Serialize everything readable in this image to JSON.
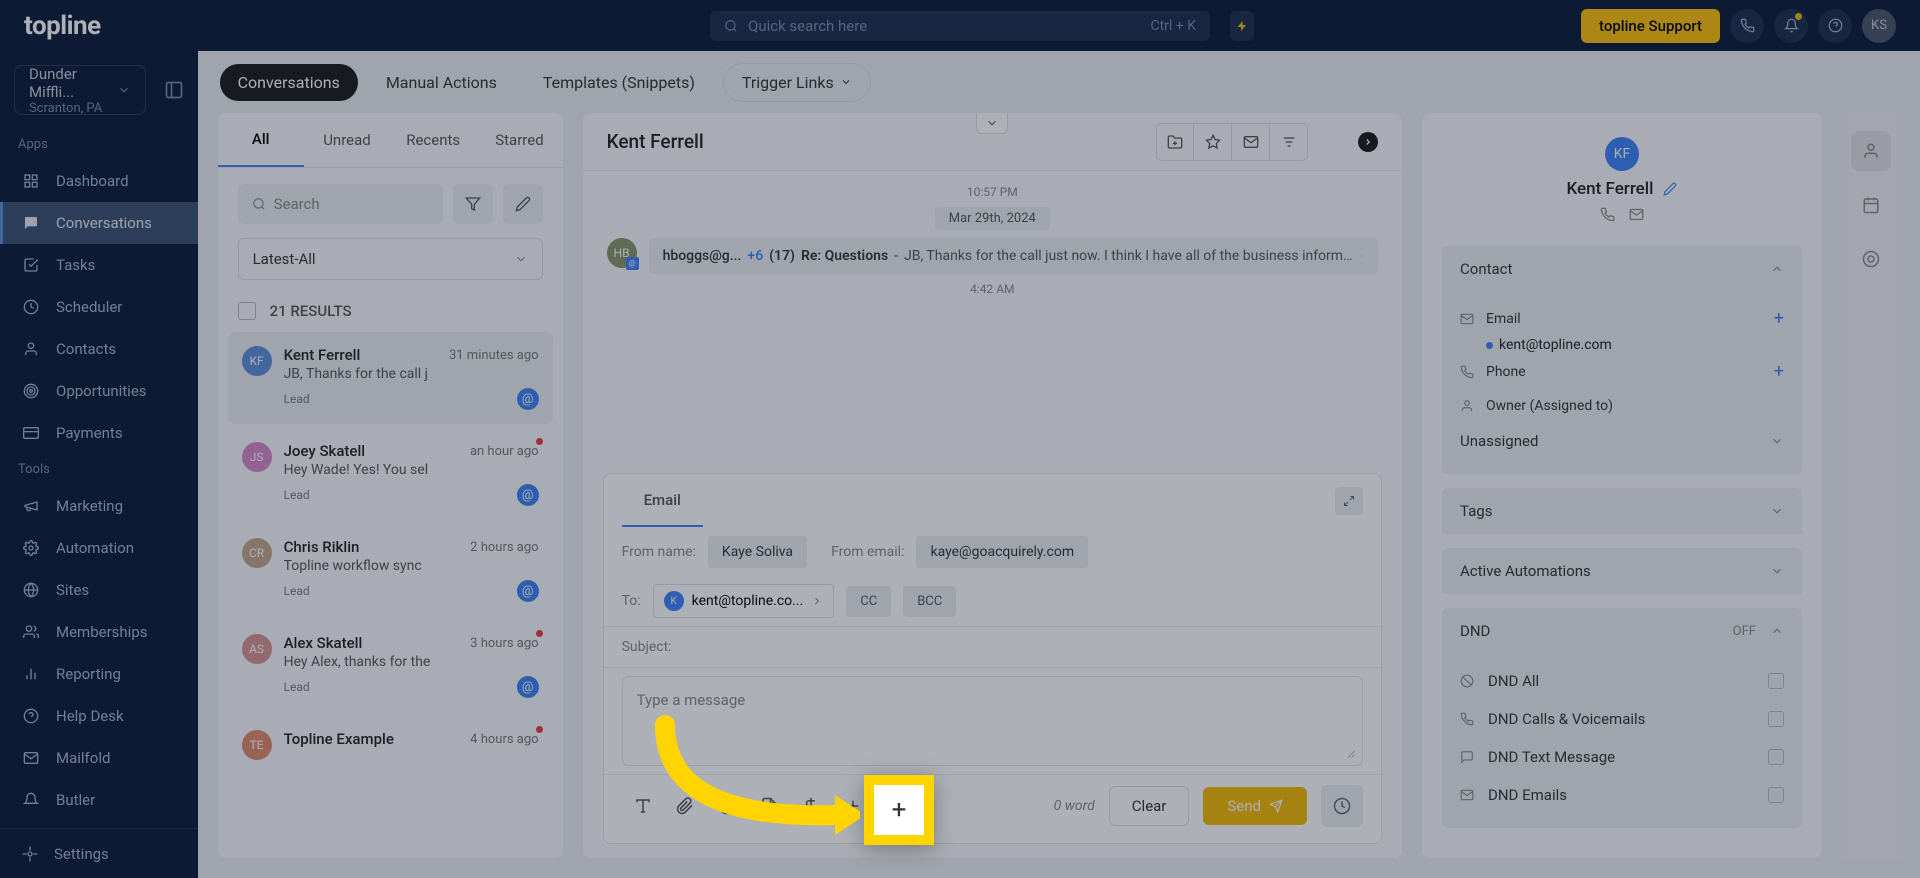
{
  "brand": "topline",
  "search": {
    "placeholder": "Quick search here",
    "shortcut": "Ctrl + K"
  },
  "support_label": "topline Support",
  "avatar_initials": "KS",
  "account": {
    "name": "Dunder Miffli...",
    "location": "Scranton, PA"
  },
  "sidebar": {
    "apps_label": "Apps",
    "tools_label": "Tools",
    "apps": [
      {
        "label": "Dashboard",
        "icon": "grid"
      },
      {
        "label": "Conversations",
        "icon": "chat",
        "active": true
      },
      {
        "label": "Tasks",
        "icon": "check"
      },
      {
        "label": "Scheduler",
        "icon": "clock"
      },
      {
        "label": "Contacts",
        "icon": "user"
      },
      {
        "label": "Opportunities",
        "icon": "target"
      },
      {
        "label": "Payments",
        "icon": "card"
      }
    ],
    "tools": [
      {
        "label": "Marketing",
        "icon": "megaphone"
      },
      {
        "label": "Automation",
        "icon": "gear"
      },
      {
        "label": "Sites",
        "icon": "globe"
      },
      {
        "label": "Memberships",
        "icon": "users"
      },
      {
        "label": "Reporting",
        "icon": "chart"
      },
      {
        "label": "Help Desk",
        "icon": "help"
      },
      {
        "label": "Mailfold",
        "icon": "mail"
      },
      {
        "label": "Butler",
        "icon": "bell"
      }
    ],
    "settings_label": "Settings"
  },
  "tabs": [
    {
      "label": "Conversations",
      "active": true
    },
    {
      "label": "Manual Actions"
    },
    {
      "label": "Templates (Snippets)"
    },
    {
      "label": "Trigger Links",
      "dropdown": true
    }
  ],
  "conv": {
    "tabs": [
      "All",
      "Unread",
      "Recents",
      "Starred"
    ],
    "search_placeholder": "Search",
    "filter": "Latest-All",
    "results_label": "21 RESULTS",
    "items": [
      {
        "initials": "KF",
        "color": "#5a8fd8",
        "name": "Kent Ferrell",
        "time": "31 minutes ago",
        "preview": "JB, Thanks for the call j",
        "tag": "Lead",
        "selected": true
      },
      {
        "initials": "JS",
        "color": "#d688c8",
        "name": "Joey Skatell",
        "time": "an hour ago",
        "preview": "Hey Wade! Yes! You sel",
        "tag": "Lead",
        "red": true
      },
      {
        "initials": "CR",
        "color": "#c0a688",
        "name": "Chris Riklin",
        "time": "2 hours ago",
        "preview": "Topline workflow sync",
        "tag": "Lead"
      },
      {
        "initials": "AS",
        "color": "#d4928f",
        "name": "Alex Skatell",
        "time": "3 hours ago",
        "preview": "Hey Alex, thanks for the",
        "tag": "Lead",
        "red": true
      },
      {
        "initials": "TE",
        "color": "#e08a6a",
        "name": "Topline Example",
        "time": "4 hours ago",
        "preview": "",
        "tag": "",
        "red": true
      }
    ]
  },
  "thread": {
    "title": "Kent Ferrell",
    "time1": "10:57 PM",
    "date": "Mar 29th, 2024",
    "msg": {
      "initials": "HB",
      "from": "hboggs@g...",
      "plus": "+6",
      "count": "(17)",
      "subject": "Re: Questions",
      "sep": "-",
      "preview": "JB, Thanks for the call just now.  I think I have all of the business informatio..."
    },
    "time2": "4:42 AM"
  },
  "composer": {
    "tab": "Email",
    "from_name_label": "From name:",
    "from_name": "Kaye Soliva",
    "from_email_label": "From email:",
    "from_email": "kaye@goacquirely.com",
    "to_label": "To:",
    "to_chip": "kent@topline.co...",
    "cc": "CC",
    "bcc": "BCC",
    "subject_label": "Subject:",
    "placeholder": "Type a message",
    "word_count": "0 word",
    "clear": "Clear",
    "send": "Send"
  },
  "details": {
    "initials": "KF",
    "name": "Kent Ferrell",
    "contact_header": "Contact",
    "email_label": "Email",
    "email_value": "kent@topline.com",
    "phone_label": "Phone",
    "owner_label": "Owner (Assigned to)",
    "owner_value": "Unassigned",
    "tags_header": "Tags",
    "automations_header": "Active Automations",
    "dnd_header": "DND",
    "dnd_status": "OFF",
    "dnd_items": [
      "DND All",
      "DND Calls & Voicemails",
      "DND Text Message",
      "DND Emails"
    ]
  }
}
